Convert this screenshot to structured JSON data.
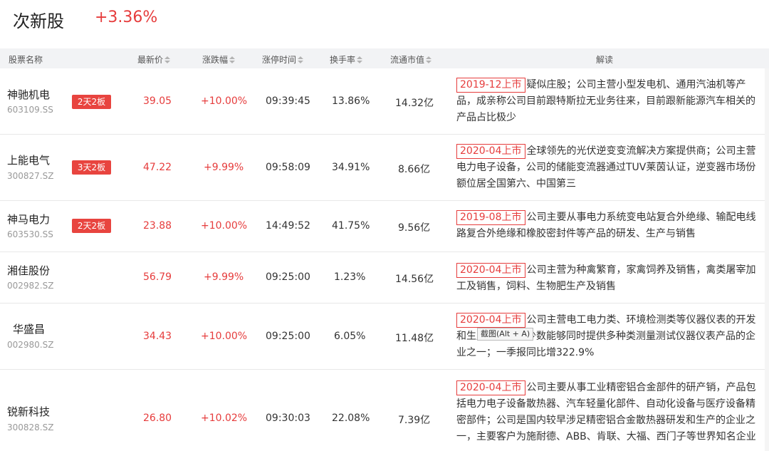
{
  "header": {
    "title": "次新股",
    "change": "+3.36%"
  },
  "columns": {
    "name": "股票名称",
    "price": "最新价",
    "pct": "涨跌幅",
    "limit_time": "涨停时间",
    "turnover": "换手率",
    "mcap": "流通市值",
    "desc": "解读"
  },
  "rows": [
    {
      "name": "神驰机电",
      "code": "603109.SS",
      "badge": "2天2板",
      "price": "39.05",
      "pct": "+10.00%",
      "time": "09:39:45",
      "turnover": "13.86%",
      "mcap": "14.32亿",
      "tag": "2019-12上市",
      "desc": "疑似庄股；公司主营小型发电机、通用汽油机等产品，成亲称公司目前跟特斯拉无业务往来，目前跟新能源汽车相关的产品占比极少"
    },
    {
      "name": "上能电气",
      "code": "300827.SZ",
      "badge": "3天2板",
      "price": "47.22",
      "pct": "+9.99%",
      "time": "09:58:09",
      "turnover": "34.91%",
      "mcap": "8.66亿",
      "tag": "2020-04上市",
      "desc": "全球领先的光伏逆变变流解决方案提供商；公司主营电力电子设备，公司的储能变流器通过TUV莱茵认证，逆变器市场份额位居全国第六、中国第三"
    },
    {
      "name": "神马电力",
      "code": "603530.SS",
      "badge": "2天2板",
      "price": "23.88",
      "pct": "+10.00%",
      "time": "14:49:52",
      "turnover": "41.75%",
      "mcap": "9.56亿",
      "tag": "2019-08上市",
      "desc": "公司主要从事电力系统变电站复合外绝缘、输配电线路复合外绝缘和橡胶密封件等产品的研发、生产与销售"
    },
    {
      "name": "湘佳股份",
      "code": "002982.SZ",
      "badge": "",
      "price": "56.79",
      "pct": "+9.99%",
      "time": "09:25:00",
      "turnover": "1.23%",
      "mcap": "14.56亿",
      "tag": "2020-04上市",
      "desc": "公司主营为种禽繁育，家禽饲养及销售，禽类屠宰加工及销售，饲料、生物肥生产及销售"
    },
    {
      "name": "华盛昌",
      "code": "002980.SZ",
      "badge": "",
      "price": "34.43",
      "pct": "+10.00%",
      "time": "09:25:00",
      "turnover": "6.05%",
      "mcap": "11.48亿",
      "tag": "2020-04上市",
      "desc": "公司主营电工电力类、环境检测类等仪器仪表的开发和生产，公司至少数能够同时提供多种类测量测试仪器仪表产品的企业之一；一季报同比增322.9%"
    },
    {
      "name": "锐新科技",
      "code": "300828.SZ",
      "badge": "",
      "price": "26.80",
      "pct": "+10.02%",
      "time": "09:30:03",
      "turnover": "22.08%",
      "mcap": "7.39亿",
      "tag": "2020-04上市",
      "desc": "公司主要从事工业精密铝合金部件的研产销，产品包括电力电子设备散热器、汽车轻量化部件、自动化设备与医疗设备精密部件；公司是国内较早涉足精密铝合金散热器研发和生产的企业之一，主要客户为施耐德、ABB、肯联、大福、西门子等世界知名企业"
    }
  ],
  "tooltip": "截图(Alt + A)"
}
